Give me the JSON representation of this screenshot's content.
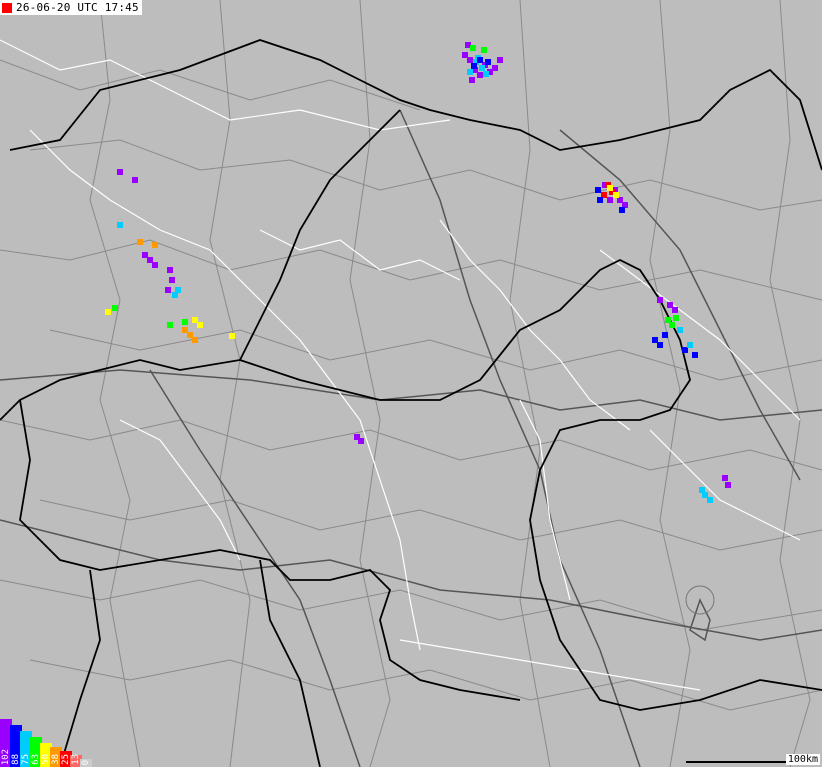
{
  "timestamp": "26-06-20 UTC 17:45",
  "scale": {
    "label": "100km"
  },
  "legend": [
    {
      "label": "102",
      "color": "#9900ff"
    },
    {
      "label": "88",
      "color": "#0000ff"
    },
    {
      "label": "75",
      "color": "#00ccff"
    },
    {
      "label": "63",
      "color": "#00ff00"
    },
    {
      "label": "50",
      "color": "#ffff00"
    },
    {
      "label": "38",
      "color": "#ff9900"
    },
    {
      "label": "25",
      "color": "#ff0000"
    },
    {
      "label": "13",
      "color": "#ff6666"
    },
    {
      "label": "0",
      "color": "#cccccc"
    }
  ],
  "colors": {
    "land": "#bdbdbd",
    "border": "#000000",
    "road_major": "#5a5a5a",
    "road_minor": "#8a8a8a",
    "river": "#ffffff"
  },
  "strike_clusters": [
    {
      "name": "north-cluster",
      "color": "#9900ff",
      "cells": [
        [
          465,
          55
        ],
        [
          470,
          60
        ],
        [
          475,
          70
        ],
        [
          480,
          75
        ],
        [
          485,
          65
        ],
        [
          490,
          72
        ],
        [
          495,
          68
        ],
        [
          468,
          45
        ],
        [
          500,
          60
        ],
        [
          472,
          80
        ]
      ]
    },
    {
      "name": "north-cluster-cyan",
      "color": "#00ccff",
      "cells": [
        [
          476,
          62
        ],
        [
          482,
          68
        ],
        [
          478,
          58
        ],
        [
          486,
          74
        ],
        [
          470,
          72
        ]
      ]
    },
    {
      "name": "north-cluster-blue",
      "color": "#0000ff",
      "cells": [
        [
          474,
          66
        ],
        [
          480,
          60
        ],
        [
          488,
          62
        ]
      ]
    },
    {
      "name": "north-cluster-green",
      "color": "#00ff00",
      "cells": [
        [
          473,
          48
        ],
        [
          484,
          50
        ]
      ]
    },
    {
      "name": "ne-cluster",
      "color": "#9900ff",
      "cells": [
        [
          605,
          185
        ],
        [
          615,
          190
        ],
        [
          620,
          200
        ],
        [
          625,
          205
        ],
        [
          610,
          200
        ]
      ]
    },
    {
      "name": "ne-cluster-red",
      "color": "#ff0000",
      "cells": [
        [
          608,
          185
        ],
        [
          612,
          192
        ],
        [
          604,
          195
        ]
      ]
    },
    {
      "name": "ne-cluster-yellow",
      "color": "#ffff00",
      "cells": [
        [
          610,
          188
        ],
        [
          616,
          195
        ]
      ]
    },
    {
      "name": "ne-cluster-blue",
      "color": "#0000ff",
      "cells": [
        [
          600,
          200
        ],
        [
          622,
          210
        ],
        [
          598,
          190
        ]
      ]
    },
    {
      "name": "east-cluster",
      "color": "#9900ff",
      "cells": [
        [
          660,
          300
        ],
        [
          670,
          305
        ],
        [
          675,
          310
        ]
      ]
    },
    {
      "name": "east-cluster-green",
      "color": "#00ff00",
      "cells": [
        [
          668,
          320
        ],
        [
          672,
          325
        ],
        [
          676,
          318
        ]
      ]
    },
    {
      "name": "east-cluster-blue",
      "color": "#0000ff",
      "cells": [
        [
          655,
          340
        ],
        [
          665,
          335
        ],
        [
          660,
          345
        ],
        [
          685,
          350
        ],
        [
          695,
          355
        ]
      ]
    },
    {
      "name": "east-cluster-cyan",
      "color": "#00ccff",
      "cells": [
        [
          680,
          330
        ],
        [
          690,
          345
        ]
      ]
    },
    {
      "name": "se-cluster",
      "color": "#00ccff",
      "cells": [
        [
          705,
          495
        ],
        [
          710,
          500
        ],
        [
          702,
          490
        ]
      ]
    },
    {
      "name": "se-cluster-purple",
      "color": "#9900ff",
      "cells": [
        [
          725,
          478
        ],
        [
          728,
          485
        ]
      ]
    },
    {
      "name": "west-cluster-purple",
      "color": "#9900ff",
      "cells": [
        [
          150,
          260
        ],
        [
          155,
          265
        ],
        [
          170,
          270
        ],
        [
          172,
          280
        ],
        [
          168,
          290
        ],
        [
          120,
          172
        ],
        [
          135,
          180
        ],
        [
          145,
          255
        ]
      ]
    },
    {
      "name": "west-cluster-orange",
      "color": "#ff9900",
      "cells": [
        [
          140,
          242
        ],
        [
          155,
          245
        ],
        [
          190,
          335
        ],
        [
          195,
          340
        ],
        [
          185,
          330
        ]
      ]
    },
    {
      "name": "west-cluster-cyan",
      "color": "#00ccff",
      "cells": [
        [
          120,
          225
        ],
        [
          175,
          295
        ],
        [
          178,
          290
        ]
      ]
    },
    {
      "name": "west-cluster-yellow",
      "color": "#ffff00",
      "cells": [
        [
          195,
          320
        ],
        [
          200,
          325
        ],
        [
          108,
          312
        ],
        [
          232,
          336
        ]
      ]
    },
    {
      "name": "west-cluster-green",
      "color": "#00ff00",
      "cells": [
        [
          115,
          308
        ],
        [
          170,
          325
        ],
        [
          185,
          322
        ]
      ]
    },
    {
      "name": "central-cell",
      "color": "#9900ff",
      "cells": [
        [
          357,
          437
        ],
        [
          361,
          441
        ]
      ]
    }
  ]
}
